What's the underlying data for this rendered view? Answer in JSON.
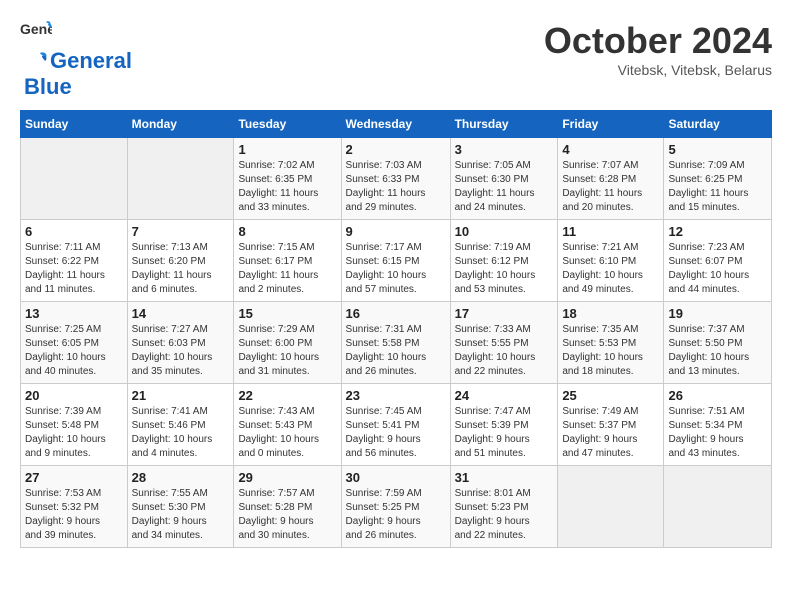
{
  "logo": {
    "line1": "General",
    "line2": "Blue"
  },
  "title": "October 2024",
  "subtitle": "Vitebsk, Vitebsk, Belarus",
  "headers": [
    "Sunday",
    "Monday",
    "Tuesday",
    "Wednesday",
    "Thursday",
    "Friday",
    "Saturday"
  ],
  "days": [
    {
      "num": "",
      "info": ""
    },
    {
      "num": "",
      "info": ""
    },
    {
      "num": "1",
      "info": "Sunrise: 7:02 AM\nSunset: 6:35 PM\nDaylight: 11 hours\nand 33 minutes."
    },
    {
      "num": "2",
      "info": "Sunrise: 7:03 AM\nSunset: 6:33 PM\nDaylight: 11 hours\nand 29 minutes."
    },
    {
      "num": "3",
      "info": "Sunrise: 7:05 AM\nSunset: 6:30 PM\nDaylight: 11 hours\nand 24 minutes."
    },
    {
      "num": "4",
      "info": "Sunrise: 7:07 AM\nSunset: 6:28 PM\nDaylight: 11 hours\nand 20 minutes."
    },
    {
      "num": "5",
      "info": "Sunrise: 7:09 AM\nSunset: 6:25 PM\nDaylight: 11 hours\nand 15 minutes."
    },
    {
      "num": "6",
      "info": "Sunrise: 7:11 AM\nSunset: 6:22 PM\nDaylight: 11 hours\nand 11 minutes."
    },
    {
      "num": "7",
      "info": "Sunrise: 7:13 AM\nSunset: 6:20 PM\nDaylight: 11 hours\nand 6 minutes."
    },
    {
      "num": "8",
      "info": "Sunrise: 7:15 AM\nSunset: 6:17 PM\nDaylight: 11 hours\nand 2 minutes."
    },
    {
      "num": "9",
      "info": "Sunrise: 7:17 AM\nSunset: 6:15 PM\nDaylight: 10 hours\nand 57 minutes."
    },
    {
      "num": "10",
      "info": "Sunrise: 7:19 AM\nSunset: 6:12 PM\nDaylight: 10 hours\nand 53 minutes."
    },
    {
      "num": "11",
      "info": "Sunrise: 7:21 AM\nSunset: 6:10 PM\nDaylight: 10 hours\nand 49 minutes."
    },
    {
      "num": "12",
      "info": "Sunrise: 7:23 AM\nSunset: 6:07 PM\nDaylight: 10 hours\nand 44 minutes."
    },
    {
      "num": "13",
      "info": "Sunrise: 7:25 AM\nSunset: 6:05 PM\nDaylight: 10 hours\nand 40 minutes."
    },
    {
      "num": "14",
      "info": "Sunrise: 7:27 AM\nSunset: 6:03 PM\nDaylight: 10 hours\nand 35 minutes."
    },
    {
      "num": "15",
      "info": "Sunrise: 7:29 AM\nSunset: 6:00 PM\nDaylight: 10 hours\nand 31 minutes."
    },
    {
      "num": "16",
      "info": "Sunrise: 7:31 AM\nSunset: 5:58 PM\nDaylight: 10 hours\nand 26 minutes."
    },
    {
      "num": "17",
      "info": "Sunrise: 7:33 AM\nSunset: 5:55 PM\nDaylight: 10 hours\nand 22 minutes."
    },
    {
      "num": "18",
      "info": "Sunrise: 7:35 AM\nSunset: 5:53 PM\nDaylight: 10 hours\nand 18 minutes."
    },
    {
      "num": "19",
      "info": "Sunrise: 7:37 AM\nSunset: 5:50 PM\nDaylight: 10 hours\nand 13 minutes."
    },
    {
      "num": "20",
      "info": "Sunrise: 7:39 AM\nSunset: 5:48 PM\nDaylight: 10 hours\nand 9 minutes."
    },
    {
      "num": "21",
      "info": "Sunrise: 7:41 AM\nSunset: 5:46 PM\nDaylight: 10 hours\nand 4 minutes."
    },
    {
      "num": "22",
      "info": "Sunrise: 7:43 AM\nSunset: 5:43 PM\nDaylight: 10 hours\nand 0 minutes."
    },
    {
      "num": "23",
      "info": "Sunrise: 7:45 AM\nSunset: 5:41 PM\nDaylight: 9 hours\nand 56 minutes."
    },
    {
      "num": "24",
      "info": "Sunrise: 7:47 AM\nSunset: 5:39 PM\nDaylight: 9 hours\nand 51 minutes."
    },
    {
      "num": "25",
      "info": "Sunrise: 7:49 AM\nSunset: 5:37 PM\nDaylight: 9 hours\nand 47 minutes."
    },
    {
      "num": "26",
      "info": "Sunrise: 7:51 AM\nSunset: 5:34 PM\nDaylight: 9 hours\nand 43 minutes."
    },
    {
      "num": "27",
      "info": "Sunrise: 7:53 AM\nSunset: 5:32 PM\nDaylight: 9 hours\nand 39 minutes."
    },
    {
      "num": "28",
      "info": "Sunrise: 7:55 AM\nSunset: 5:30 PM\nDaylight: 9 hours\nand 34 minutes."
    },
    {
      "num": "29",
      "info": "Sunrise: 7:57 AM\nSunset: 5:28 PM\nDaylight: 9 hours\nand 30 minutes."
    },
    {
      "num": "30",
      "info": "Sunrise: 7:59 AM\nSunset: 5:25 PM\nDaylight: 9 hours\nand 26 minutes."
    },
    {
      "num": "31",
      "info": "Sunrise: 8:01 AM\nSunset: 5:23 PM\nDaylight: 9 hours\nand 22 minutes."
    },
    {
      "num": "",
      "info": ""
    },
    {
      "num": "",
      "info": ""
    },
    {
      "num": "",
      "info": ""
    }
  ]
}
